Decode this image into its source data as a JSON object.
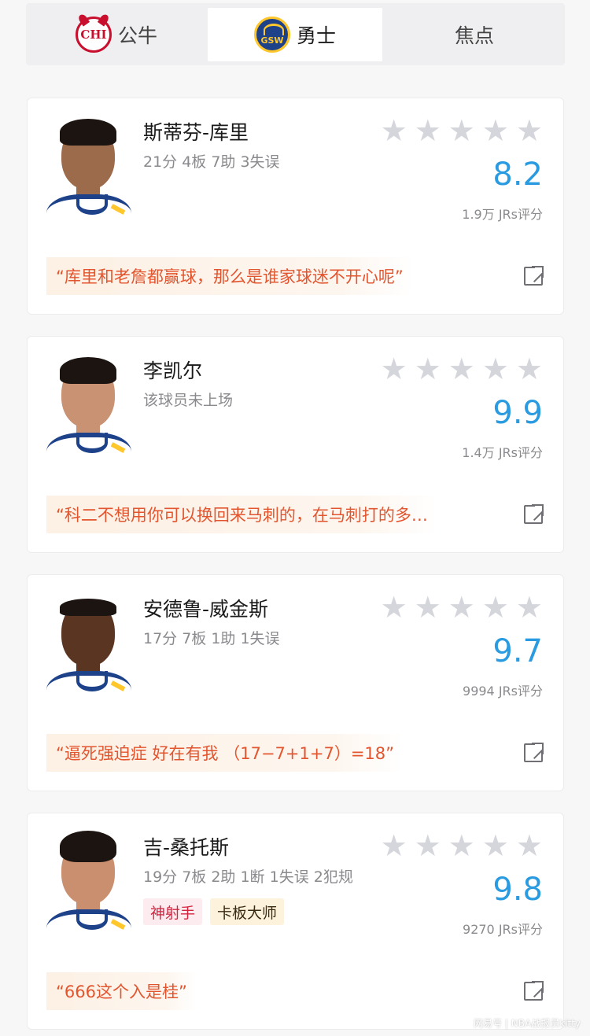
{
  "tabs": [
    {
      "label": "公牛",
      "logo_text": "CHI",
      "icon": "chicago-bulls-logo-icon",
      "active": false
    },
    {
      "label": "勇士",
      "logo_text": "GSW",
      "icon": "golden-state-warriors-logo-icon",
      "active": true
    },
    {
      "label": "焦点",
      "active": false
    }
  ],
  "colors": {
    "accent": "#2a9be0",
    "quote_text": "#e2552e",
    "star_inactive": "#d4d6dc"
  },
  "players": [
    {
      "name": "斯蒂芬-库里",
      "stats": "21分 4板 7助 3失误",
      "rating": "8.2",
      "rating_count": "1.9万 JRs评分",
      "stars_total": 5,
      "quote": "“库里和老詹都赢球，那么是谁家球迷不开心呢”",
      "tags": []
    },
    {
      "name": "李凯尔",
      "stats": "该球员未上场",
      "rating": "9.9",
      "rating_count": "1.4万 JRs评分",
      "stars_total": 5,
      "quote": "“科二不想用你可以换回来马刺的，在马刺打的多…",
      "tags": []
    },
    {
      "name": "安德鲁-威金斯",
      "stats": "17分 7板 1助 1失误",
      "rating": "9.7",
      "rating_count": "9994 JRs评分",
      "stars_total": 5,
      "quote": "“逼死强迫症 好在有我 （17−7+1+7）=18”",
      "tags": []
    },
    {
      "name": "吉-桑托斯",
      "stats": "19分 7板 2助 1断 1失误 2犯规",
      "rating": "9.8",
      "rating_count": "9270 JRs评分",
      "stars_total": 5,
      "quote": "“666这个入是桂”",
      "tags": [
        "神射手",
        "卡板大师"
      ]
    }
  ],
  "watermark": "网易号 | NBA战报员kitty"
}
